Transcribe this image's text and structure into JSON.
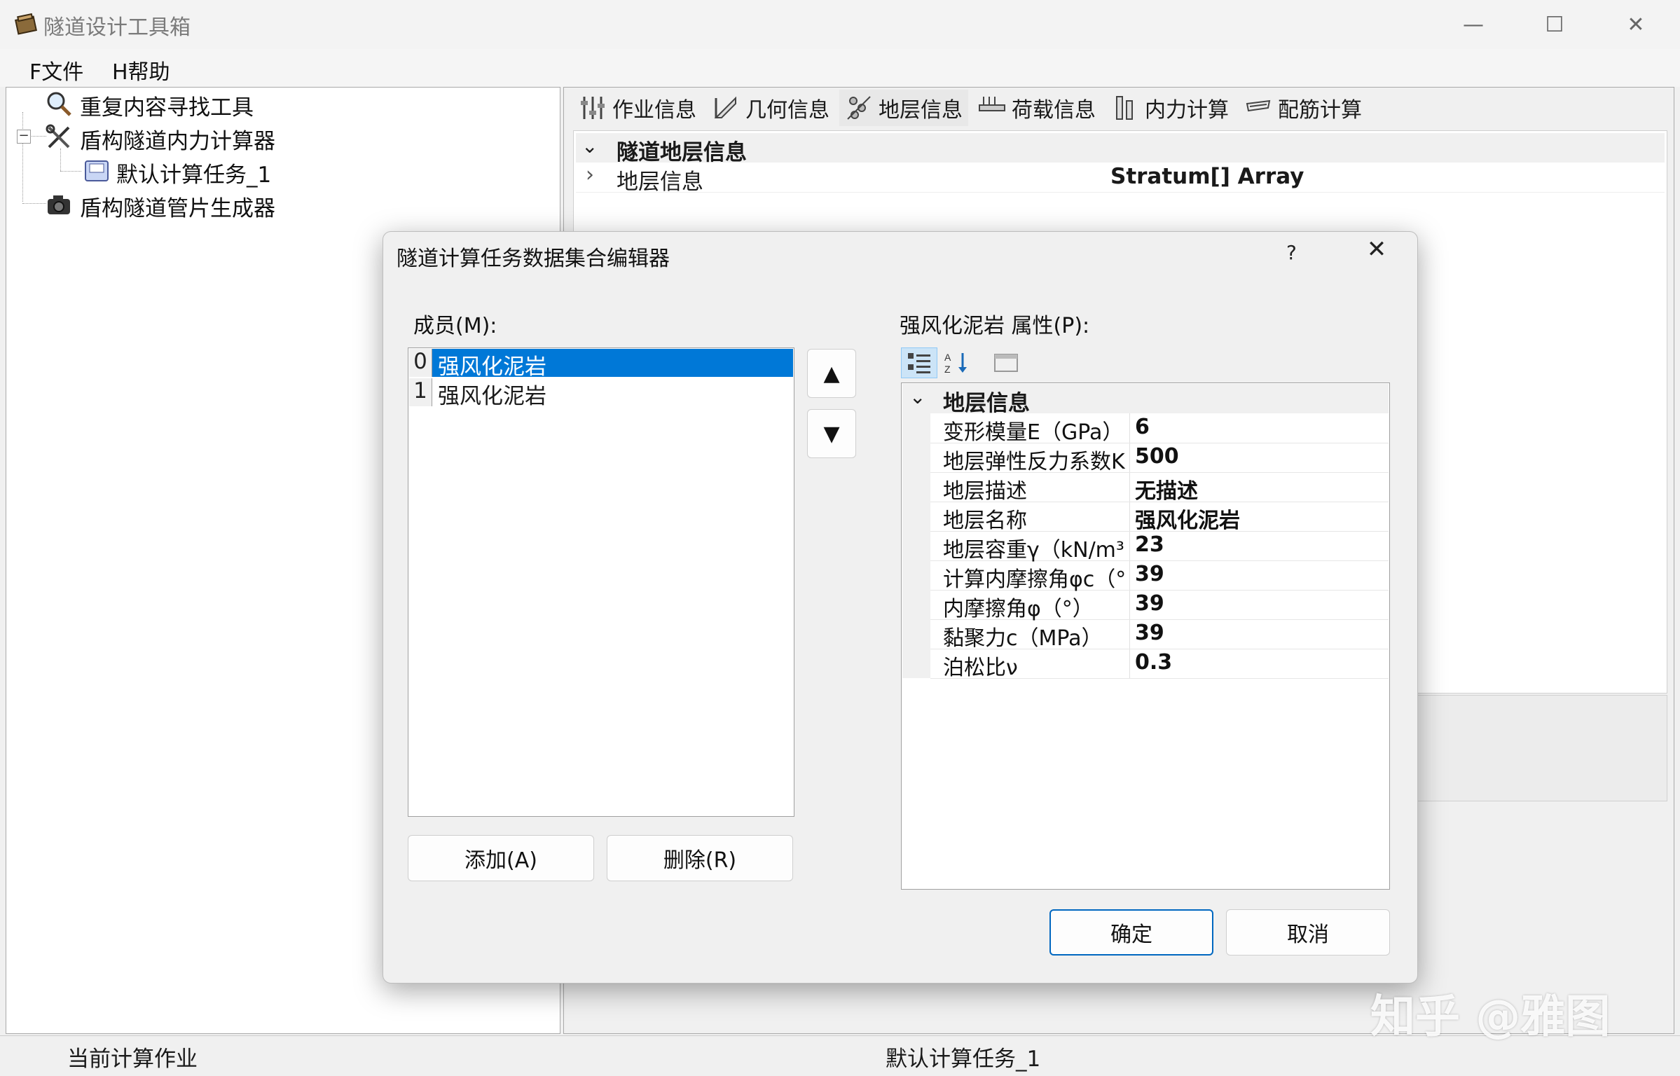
{
  "window": {
    "title": "隧道设计工具箱",
    "icon": "toolbox-icon",
    "controls": [
      "minimize-icon",
      "maximize-icon",
      "close-icon"
    ]
  },
  "menu": {
    "file": "F文件",
    "help": "H帮助"
  },
  "tree": {
    "items": [
      {
        "label": "重复内容寻找工具",
        "icon": "magnifier-icon"
      },
      {
        "label": "盾构隧道内力计算器",
        "icon": "tools-icon",
        "expanded": true
      },
      {
        "label": "默认计算任务_1",
        "icon": "document-icon"
      },
      {
        "label": "盾构隧道管片生成器",
        "icon": "camera-icon"
      }
    ]
  },
  "tabs": [
    {
      "label": "作业信息",
      "icon": "sliders-icon"
    },
    {
      "label": "几何信息",
      "icon": "ruler-icon"
    },
    {
      "label": "地层信息",
      "icon": "layers-icon",
      "active": true
    },
    {
      "label": "荷载信息",
      "icon": "load-icon"
    },
    {
      "label": "内力计算",
      "icon": "force-icon"
    },
    {
      "label": "配筋计算",
      "icon": "rebar-icon"
    }
  ],
  "main_grid": {
    "category": "隧道地层信息",
    "row_name": "地层信息",
    "row_value": "Stratum[] Array"
  },
  "status": {
    "left": "当前计算作业",
    "center": "默认计算任务_1"
  },
  "dialog": {
    "title": "隧道计算任务数据集合编辑器",
    "help": "?",
    "members_label": "成员(M):",
    "members": [
      {
        "index": "0",
        "name": "强风化泥岩",
        "selected": true
      },
      {
        "index": "1",
        "name": "强风化泥岩",
        "selected": false
      }
    ],
    "move_up": "▲",
    "move_down": "▼",
    "add_button": "添加(A)",
    "remove_button": "删除(R)",
    "props_label": "强风化泥岩 属性(P):",
    "props_category": "地层信息",
    "props": [
      {
        "name": "变形模量E（GPa）",
        "value": "6"
      },
      {
        "name": "地层弹性反力系数K",
        "value": "500"
      },
      {
        "name": "地层描述",
        "value": "无描述"
      },
      {
        "name": "地层名称",
        "value": "强风化泥岩"
      },
      {
        "name": "地层容重γ（kN/m³",
        "value": "23"
      },
      {
        "name": "计算内摩擦角φc（°",
        "value": "39"
      },
      {
        "name": "内摩擦角φ（°）",
        "value": "39"
      },
      {
        "name": "黏聚力c（MPa）",
        "value": "39"
      },
      {
        "name": "泊松比ν",
        "value": "0.3"
      }
    ],
    "ok_button": "确定",
    "cancel_button": "取消"
  },
  "watermark": "知乎 @雅图",
  "colors": {
    "selection": "#0078d7",
    "primary_border": "#0067c0"
  }
}
